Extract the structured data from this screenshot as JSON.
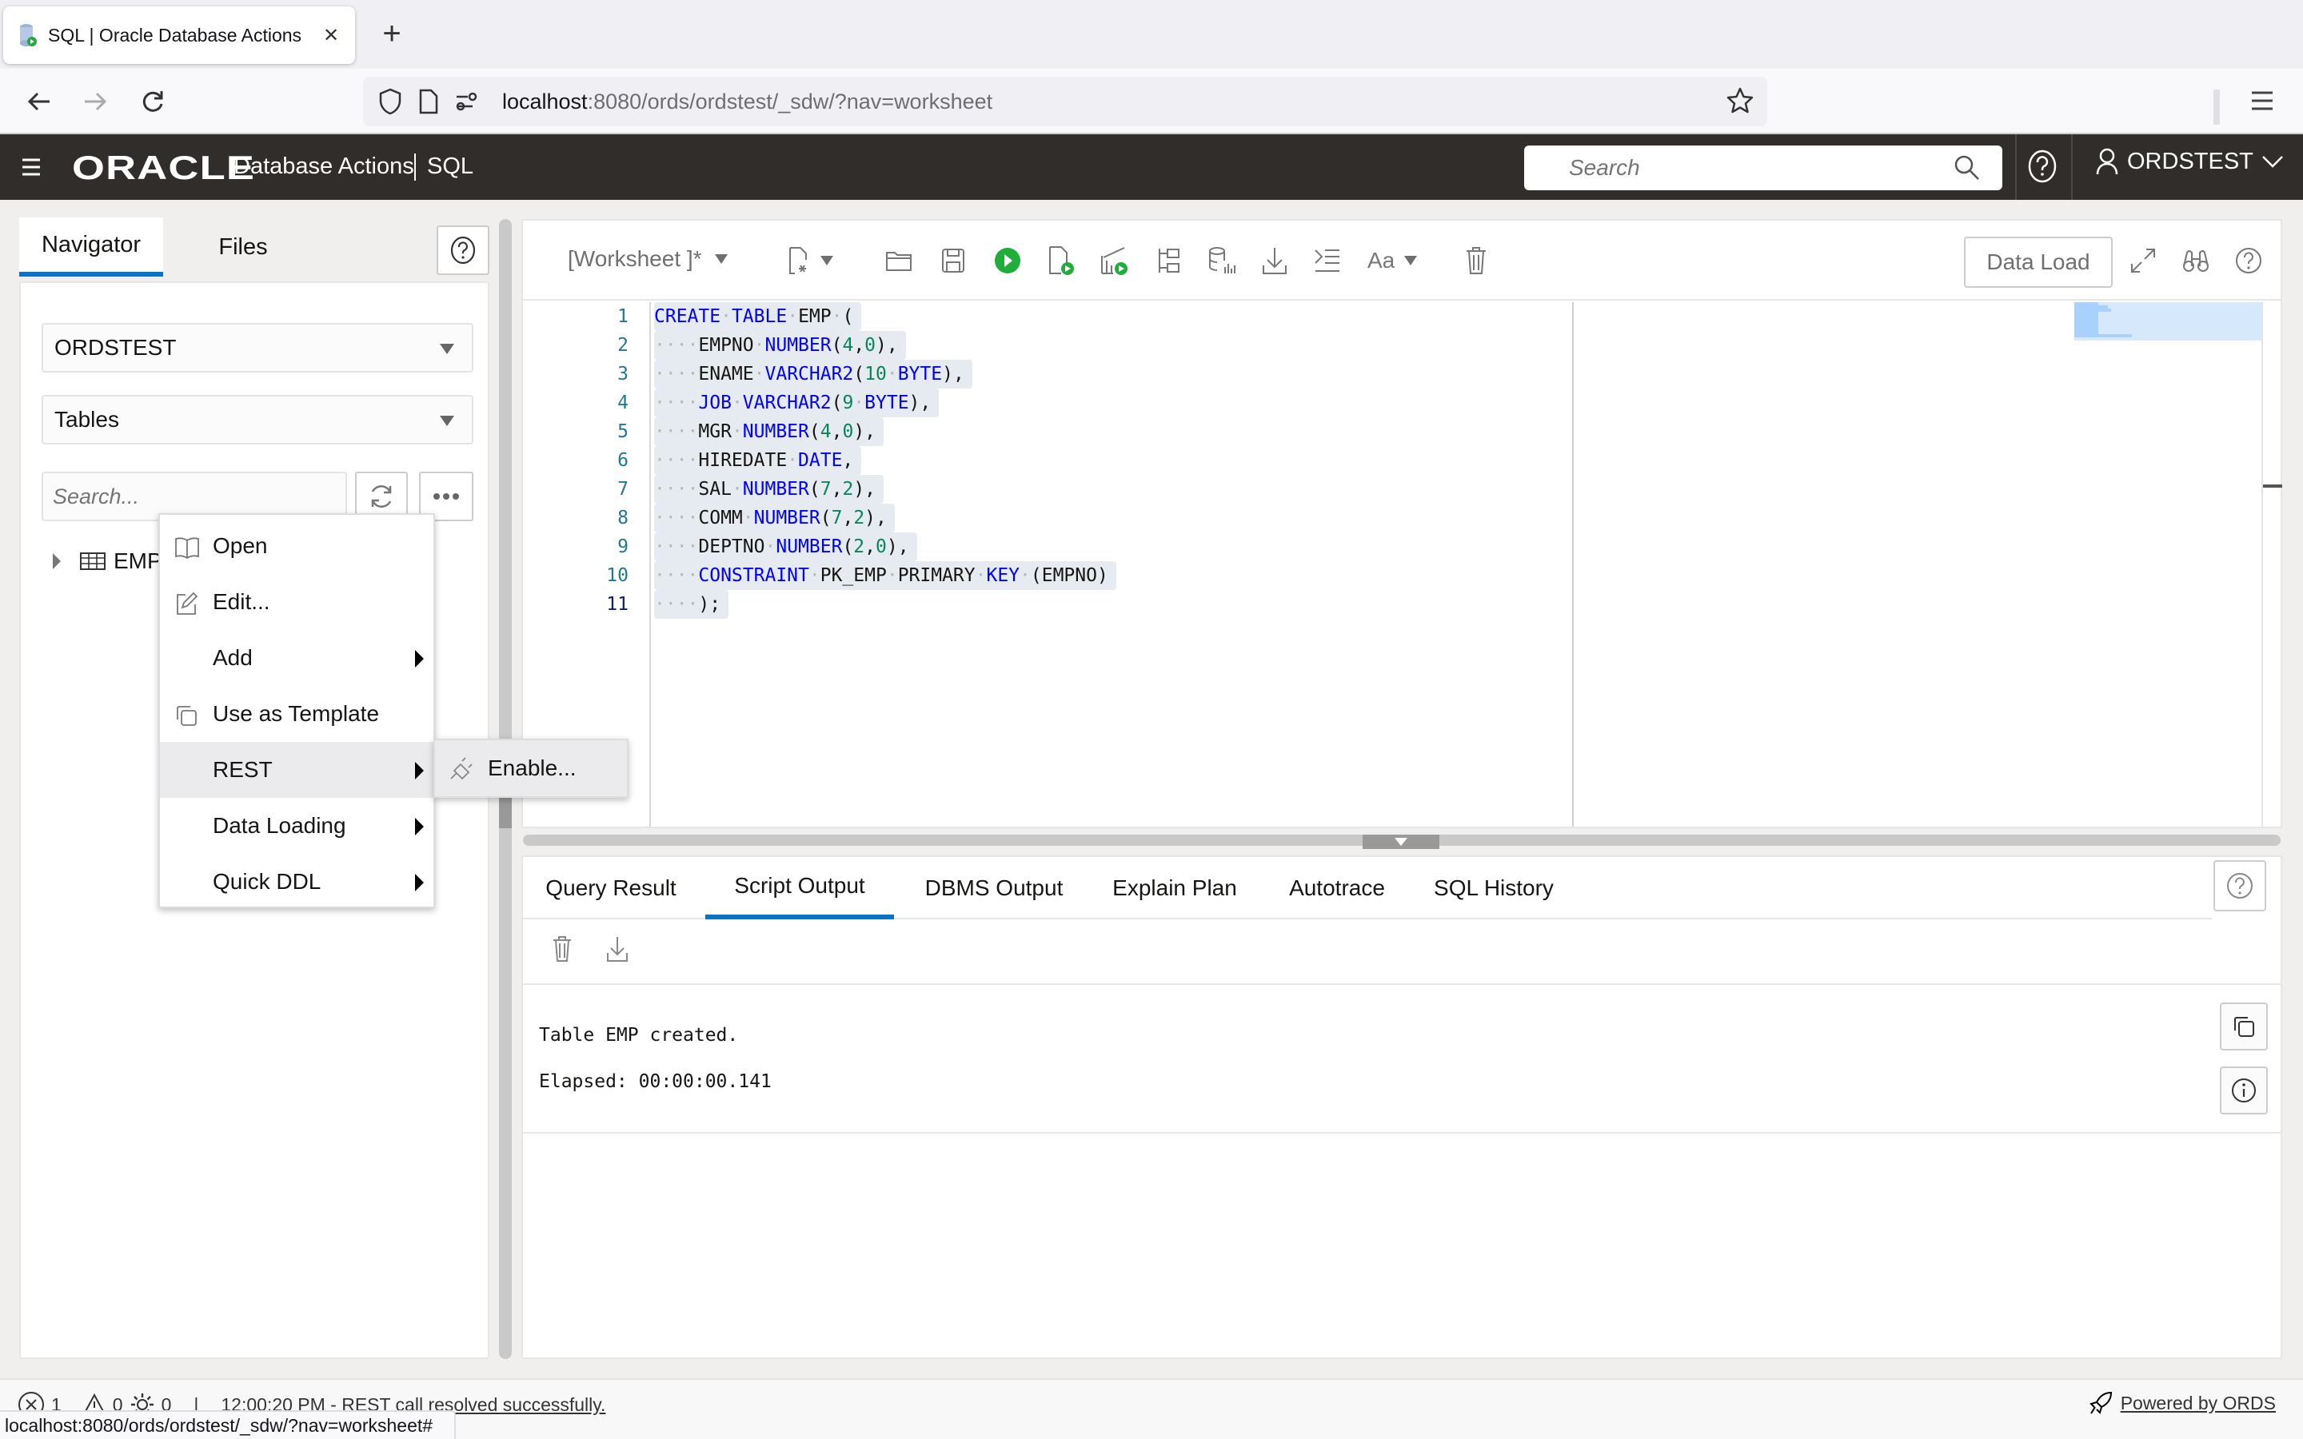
{
  "browser": {
    "tab_title": "SQL | Oracle Database Actions",
    "new_tab_label": "+",
    "url_host": "localhost",
    "url_rest": ":8080/ords/ordstest/_sdw/?nav=worksheet",
    "link_preview": "localhost:8080/ords/ordstest/_sdw/?nav=worksheet#"
  },
  "header": {
    "logo": "ORACLE",
    "app_name": "Database Actions",
    "page": "SQL",
    "search_placeholder": "Search",
    "user": "ORDSTEST"
  },
  "navigator": {
    "tabs": [
      {
        "label": "Navigator",
        "active": true
      },
      {
        "label": "Files",
        "active": false
      }
    ],
    "schema": "ORDSTEST",
    "object_type": "Tables",
    "search_placeholder": "Search...",
    "tree": [
      {
        "label": "EMP",
        "type": "table"
      }
    ]
  },
  "context_menu": {
    "items": [
      {
        "label": "Open",
        "icon": "book-open-icon",
        "submenu": false
      },
      {
        "label": "Edit...",
        "icon": "pencil-edit-icon",
        "submenu": false
      },
      {
        "label": "Add",
        "icon": "",
        "submenu": true
      },
      {
        "label": "Use as Template",
        "icon": "copy-icon",
        "submenu": false
      },
      {
        "label": "REST",
        "icon": "",
        "submenu": true,
        "highlighted": true
      },
      {
        "label": "Data Loading",
        "icon": "",
        "submenu": true
      },
      {
        "label": "Quick DDL",
        "icon": "",
        "submenu": true
      }
    ],
    "rest_submenu": [
      {
        "label": "Enable...",
        "icon": "plug-icon"
      }
    ]
  },
  "editor": {
    "worksheet_label": "[Worksheet ]*",
    "data_load_label": "Data Load",
    "toolbar_icons": [
      "new-worksheet-icon",
      "open-folder-icon",
      "save-icon",
      "run-statement-icon",
      "run-script-icon",
      "explain-plan-run-icon",
      "explain-plan-icon",
      "autotrace-icon",
      "download-icon",
      "format-icon",
      "font-case-icon",
      "trash-icon"
    ],
    "code_lines": [
      [
        [
          "kw",
          "CREATE"
        ],
        [
          "ws",
          "·"
        ],
        [
          "kw",
          "TABLE"
        ],
        [
          "ws",
          "·"
        ],
        [
          "id",
          "EMP"
        ],
        [
          "ws",
          "·"
        ],
        [
          "id",
          "("
        ]
      ],
      [
        [
          "ws",
          "····"
        ],
        [
          "id",
          "EMPNO"
        ],
        [
          "ws",
          "·"
        ],
        [
          "kw",
          "NUMBER"
        ],
        [
          "id",
          "("
        ],
        [
          "num",
          "4"
        ],
        [
          "id",
          ","
        ],
        [
          "num",
          "0"
        ],
        [
          "id",
          "),"
        ]
      ],
      [
        [
          "ws",
          "····"
        ],
        [
          "id",
          "ENAME"
        ],
        [
          "ws",
          "·"
        ],
        [
          "kw",
          "VARCHAR2"
        ],
        [
          "id",
          "("
        ],
        [
          "num",
          "10"
        ],
        [
          "ws",
          "·"
        ],
        [
          "kw",
          "BYTE"
        ],
        [
          "id",
          "),"
        ]
      ],
      [
        [
          "ws",
          "····"
        ],
        [
          "kw",
          "JOB"
        ],
        [
          "ws",
          "·"
        ],
        [
          "kw",
          "VARCHAR2"
        ],
        [
          "id",
          "("
        ],
        [
          "num",
          "9"
        ],
        [
          "ws",
          "·"
        ],
        [
          "kw",
          "BYTE"
        ],
        [
          "id",
          "),"
        ]
      ],
      [
        [
          "ws",
          "····"
        ],
        [
          "id",
          "MGR"
        ],
        [
          "ws",
          "·"
        ],
        [
          "kw",
          "NUMBER"
        ],
        [
          "id",
          "("
        ],
        [
          "num",
          "4"
        ],
        [
          "id",
          ","
        ],
        [
          "num",
          "0"
        ],
        [
          "id",
          "),"
        ]
      ],
      [
        [
          "ws",
          "····"
        ],
        [
          "id",
          "HIREDATE"
        ],
        [
          "ws",
          "·"
        ],
        [
          "kw",
          "DATE"
        ],
        [
          "id",
          ","
        ]
      ],
      [
        [
          "ws",
          "····"
        ],
        [
          "id",
          "SAL"
        ],
        [
          "ws",
          "·"
        ],
        [
          "kw",
          "NUMBER"
        ],
        [
          "id",
          "("
        ],
        [
          "num",
          "7"
        ],
        [
          "id",
          ","
        ],
        [
          "num",
          "2"
        ],
        [
          "id",
          "),"
        ]
      ],
      [
        [
          "ws",
          "····"
        ],
        [
          "id",
          "COMM"
        ],
        [
          "ws",
          "·"
        ],
        [
          "kw",
          "NUMBER"
        ],
        [
          "id",
          "("
        ],
        [
          "num",
          "7"
        ],
        [
          "id",
          ","
        ],
        [
          "num",
          "2"
        ],
        [
          "id",
          "),"
        ]
      ],
      [
        [
          "ws",
          "····"
        ],
        [
          "id",
          "DEPTNO"
        ],
        [
          "ws",
          "·"
        ],
        [
          "kw",
          "NUMBER"
        ],
        [
          "id",
          "("
        ],
        [
          "num",
          "2"
        ],
        [
          "id",
          ","
        ],
        [
          "num",
          "0"
        ],
        [
          "id",
          "),"
        ]
      ],
      [
        [
          "ws",
          "····"
        ],
        [
          "kw",
          "CONSTRAINT"
        ],
        [
          "ws",
          "·"
        ],
        [
          "id",
          "PK_EMP"
        ],
        [
          "ws",
          "·"
        ],
        [
          "id",
          "PRIMARY"
        ],
        [
          "ws",
          "·"
        ],
        [
          "kw",
          "KEY"
        ],
        [
          "ws",
          "·"
        ],
        [
          "id",
          "(EMPNO)"
        ]
      ],
      [
        [
          "ws",
          "····"
        ],
        [
          "id",
          ");"
        ]
      ]
    ],
    "current_line": 11
  },
  "output": {
    "tabs": [
      {
        "label": "Query Result",
        "active": false
      },
      {
        "label": "Script Output",
        "active": true
      },
      {
        "label": "DBMS Output",
        "active": false
      },
      {
        "label": "Explain Plan",
        "active": false
      },
      {
        "label": "Autotrace",
        "active": false
      },
      {
        "label": "SQL History",
        "active": false
      }
    ],
    "lines": [
      "Table EMP created.",
      "Elapsed: 00:00:00.141"
    ]
  },
  "status": {
    "errors": "1",
    "warnings": "0",
    "tasks": "0",
    "separator": "|",
    "message_time": "12:00:20 PM - ",
    "message_rest": "REST call resolved successfully.",
    "powered_by": "Powered by ORDS"
  },
  "colors": {
    "accent": "#0a73c5",
    "header_bg": "#312d2a",
    "run_green": "#1fae3a",
    "keyword": "#0000ff",
    "number": "#098658",
    "line_number": "#237893"
  }
}
